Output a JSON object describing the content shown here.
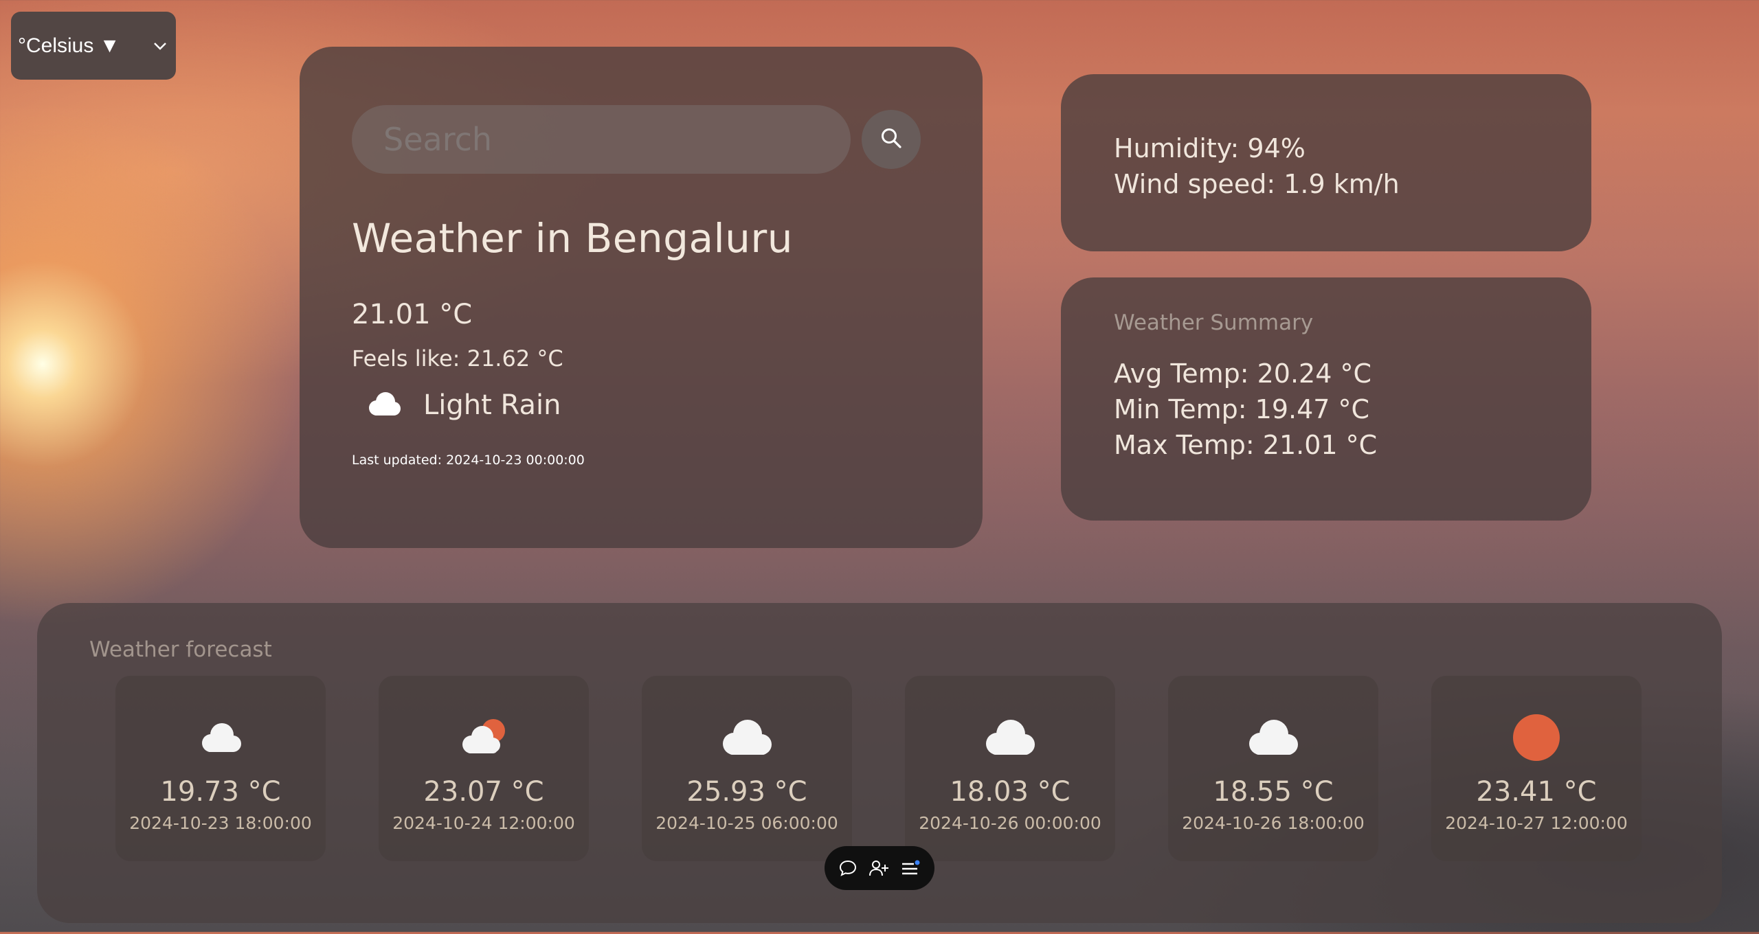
{
  "unit_select": {
    "value": "°Celsius ▼"
  },
  "search": {
    "placeholder": "Search"
  },
  "current": {
    "city_title": "Weather in Bengaluru",
    "temp": "21.01 °C",
    "feels_like": "Feels like: 21.62 °C",
    "description": "Light Rain",
    "icon": "cloud-icon",
    "last_updated": "Last updated: 2024-10-23 00:00:00"
  },
  "details": {
    "humidity": "Humidity: 94%",
    "wind": "Wind speed: 1.9 km/h"
  },
  "summary": {
    "title": "Weather Summary",
    "avg": "Avg Temp: 20.24 °C",
    "min": "Min Temp: 19.47 °C",
    "max": "Max Temp: 21.01 °C"
  },
  "forecast": {
    "title": "Weather forecast",
    "items": [
      {
        "temp": "19.73 °C",
        "date": "2024-10-23 18:00:00",
        "icon": "cloud-icon"
      },
      {
        "temp": "23.07 °C",
        "date": "2024-10-24 12:00:00",
        "icon": "partly-cloudy-icon"
      },
      {
        "temp": "25.93 °C",
        "date": "2024-10-25 06:00:00",
        "icon": "cloud-icon"
      },
      {
        "temp": "18.03 °C",
        "date": "2024-10-26 00:00:00",
        "icon": "cloud-icon"
      },
      {
        "temp": "18.55 °C",
        "date": "2024-10-26 18:00:00",
        "icon": "cloud-icon"
      },
      {
        "temp": "23.41 °C",
        "date": "2024-10-27 12:00:00",
        "icon": "sun-icon"
      }
    ]
  },
  "toolbar": {
    "icons": [
      "chat-icon",
      "add-user-icon",
      "menu-icon"
    ]
  },
  "colors": {
    "sun": "#e0623e",
    "panel": "#4a3e3e",
    "text": "#f0e6dc"
  }
}
